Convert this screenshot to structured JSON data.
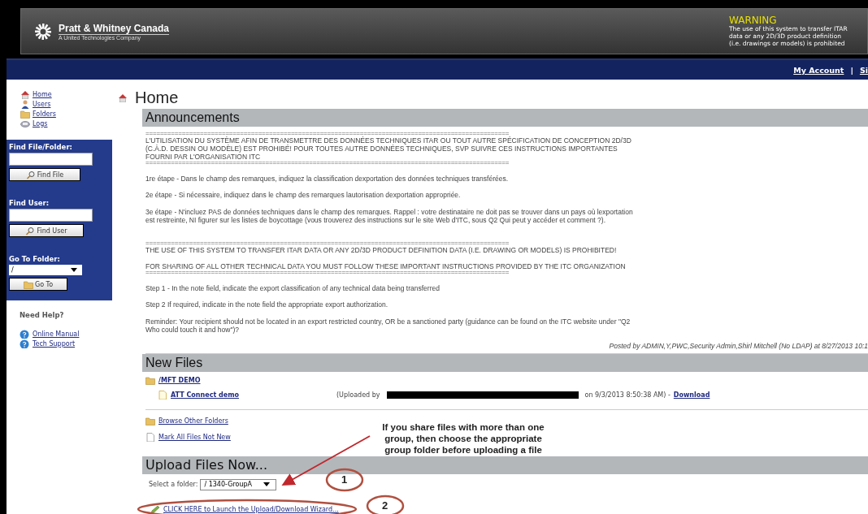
{
  "header": {
    "logo": {
      "name": "Pratt & Whitney Canada",
      "tagline": "A United Technologies Company"
    },
    "warning": {
      "title": "WARNING",
      "lines": [
        "The use of this system to transfer ITAR",
        "data or any 2D/3D product definition",
        "(i.e. drawings or models) is prohibited"
      ]
    }
  },
  "top_nav": {
    "links": [
      {
        "label": "My Account"
      },
      {
        "label": "Si"
      }
    ],
    "separator": "|"
  },
  "sidebar": {
    "nav": [
      {
        "label": "Home",
        "kind": "house"
      },
      {
        "label": "Users",
        "kind": "user"
      },
      {
        "label": "Folders",
        "kind": "folder"
      },
      {
        "label": "Logs",
        "kind": "logs"
      }
    ],
    "find_file": {
      "label": "Find File/Folder:",
      "button": "Find File"
    },
    "find_user": {
      "label": "Find User:",
      "button": "Find User"
    },
    "go_to_folder": {
      "label": "Go To Folder:",
      "value": "/",
      "button": "Go To"
    },
    "help": {
      "title": "Need Help?",
      "links": [
        {
          "label": "Online Manual"
        },
        {
          "label": "Tech Support"
        }
      ]
    }
  },
  "page": {
    "title": "Home",
    "announcements": {
      "heading": "Announcements",
      "blocks": [
        {
          "kind": "rule",
          "text": "===================================================================================================="
        },
        {
          "kind": "para",
          "text": "L'UTILISATION DU SYSTÈME AFIN DE TRANSMETTRE DES DONNÉES TECHNIQUES ITAR OU TOUT AUTRE SPÉCIFICATION DE CONCEPTION 2D/3D (C.À.D. DESSIN OU MODÈLE) EST PROHIBÉ! POUR TOUTES AUTRE DONNÉES TECHNIQUES, SVP SUIVRE CES INSTRUCTIONS IMPORTANTES FOURNI PAR L'ORGANISATION ITC"
        },
        {
          "kind": "rule",
          "text": "===================================================================================================="
        },
        {
          "kind": "gap"
        },
        {
          "kind": "para",
          "text": "1re étape - Dans le champ des remarques, indiquez la classification dexportation des données techniques transférées."
        },
        {
          "kind": "gap"
        },
        {
          "kind": "para",
          "text": "2e étape - Si nécessaire, indiquez dans le champ des remarques lautorisation dexportation appropriée."
        },
        {
          "kind": "gap"
        },
        {
          "kind": "para",
          "text": "3e étape - N'incluez PAS de données techniques dans le champ des remarques. Rappel : votre destinataire ne doit pas se trouver dans un pays où lexportation est restreinte, NI figurer sur les listes de boycottage (vous trouverez des instructions sur le site Web d'ITC, sous Q2 Qui peut y accéder et comment ?)."
        },
        {
          "kind": "gap"
        },
        {
          "kind": "gap"
        },
        {
          "kind": "rule",
          "text": "===================================================================================================="
        },
        {
          "kind": "para",
          "text": "THE USE OF THIS SYSTEM TO TRANSFER ITAR DATA OR ANY 2D/3D PRODUCT DEFINITION DATA (I.E. DRAWING OR MODELS) IS PROHIBITED!"
        },
        {
          "kind": "gap"
        },
        {
          "kind": "para",
          "text": "FOR SHARING OF ALL OTHER TECHNICAL DATA YOU MUST FOLLOW THESE IMPORTANT INSTRUCTIONS PROVIDED BY THE ITC ORGANIZATION"
        },
        {
          "kind": "rule",
          "text": "===================================================================================================="
        },
        {
          "kind": "gap"
        },
        {
          "kind": "para",
          "text": "Step 1 - In the note field, indicate the export classification of any technical data being transferred"
        },
        {
          "kind": "gap"
        },
        {
          "kind": "para",
          "text": "Step 2 If required, indicate in the note field the appropriate export authorization."
        },
        {
          "kind": "gap"
        },
        {
          "kind": "para",
          "text": "Reminder: Your recipient should not be located in an export restricted country, OR be a sanctioned party (guidance can be found on the ITC website under \"Q2 Who could touch it and how\")?"
        }
      ],
      "posted": "Posted by ADMIN,Y,PWC,Security Admin,Shirl Mitchell (No LDAP) at 8/27/2013 10:1"
    },
    "new_files": {
      "heading": "New Files",
      "folder": "/MFT DEMO",
      "files": [
        {
          "name": "ATT Connect demo",
          "uploaded_prefix": "(Uploaded by",
          "redacted": true,
          "uploaded_suffix": "on 9/3/2013 8:50:38 AM) -",
          "link": "Download"
        }
      ],
      "actions": [
        {
          "label": "Browse Other Folders",
          "kind": "folder"
        },
        {
          "label": "Mark All Files Not New",
          "kind": "page"
        }
      ]
    },
    "upload": {
      "heading": "Upload Files Now...",
      "folder_label": "Select a folder:",
      "folder_value": "/ 1340-GroupA",
      "wizard_link": "CLICK HERE to Launch the Upload/Download Wizard..."
    }
  },
  "annotations": {
    "callout": [
      "If you share files with more than one",
      "group, then choose the appropriate",
      "group folder before uploading a file"
    ],
    "markers": [
      "1",
      "2"
    ]
  }
}
